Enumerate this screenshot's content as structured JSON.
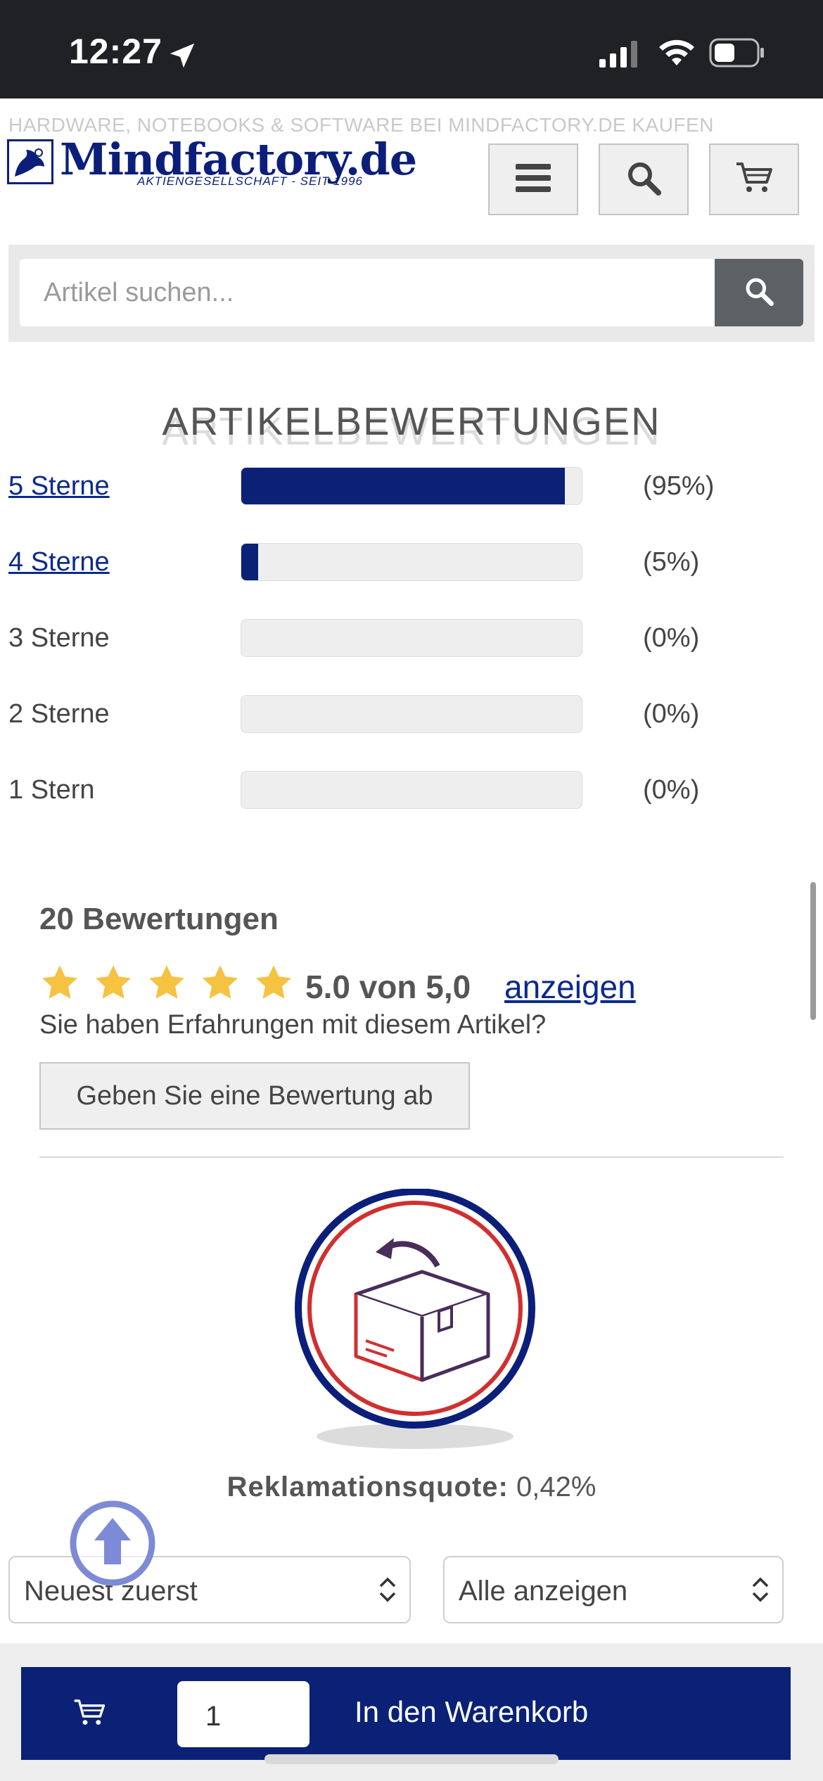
{
  "status_bar": {
    "time": "12:27"
  },
  "header": {
    "tagline": "HARDWARE, NOTEBOOKS & SOFTWARE BEI MINDFACTORY.DE KAUFEN",
    "logo_text": "Mindfactory.de",
    "logo_sub": "AKTIENGESELLSCHAFT - SEIT 1996"
  },
  "search": {
    "placeholder": "Artikel suchen..."
  },
  "ratings": {
    "title": "ARTIKELBEWERTUNGEN",
    "rows": [
      {
        "label": "5 Sterne",
        "percent_text": "(95%)",
        "value": 0.95
      },
      {
        "label": "4 Sterne",
        "percent_text": "(5%)",
        "value": 0.05
      },
      {
        "label": "3 Sterne",
        "percent_text": "(0%)",
        "value": 0.0
      },
      {
        "label": "2 Sterne",
        "percent_text": "(0%)",
        "value": 0.0
      },
      {
        "label": "1 Stern",
        "percent_text": "(0%)",
        "value": 0.0
      }
    ],
    "count_title": "20 Bewertungen",
    "stars": 5,
    "average_text": "5.0 von 5,0",
    "show_link": "anzeigen",
    "question": "Sie haben Erfahrungen mit diesem Artikel?",
    "review_button": "Geben Sie eine Bewertung ab"
  },
  "returns": {
    "label": "Reklamationsquote:",
    "value": "0,42%"
  },
  "sort": {
    "order_selected": "Neuest zuerst",
    "filter_selected": "Alle anzeigen"
  },
  "cart": {
    "quantity": "1",
    "button_label": "In den Warenkorb"
  },
  "colors": {
    "brand_blue": "#0a2176",
    "link_blue": "#0b2a8a",
    "star_yellow": "#f5c242",
    "status_bar": "#202124",
    "search_button": "#5d6166"
  }
}
